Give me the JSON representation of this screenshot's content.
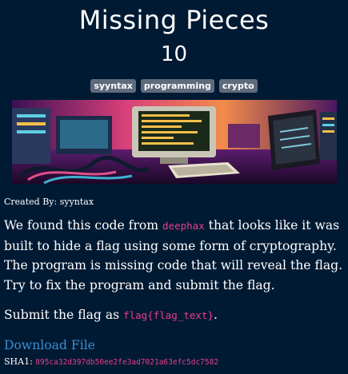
{
  "challenge": {
    "title": "Missing Pieces",
    "points": "10",
    "tags": [
      "syyntax",
      "programming",
      "crypto"
    ],
    "created_by_label": "Created By:",
    "created_by": "syyntax",
    "description": {
      "part1": "We found this code from ",
      "code1": "deephax",
      "part2": " that looks like it was built to hide a flag using some form of cryptography. The program is missing code that will reveal the flag. Try to fix the program and submit the flag."
    },
    "submit": {
      "prefix": "Submit the flag as ",
      "format": "flag{flag_text}",
      "suffix": "."
    },
    "download_label": "Download File",
    "sha1_label": "SHA1:",
    "sha1": "895ca32d397db50ee2fe3ad7021a63efc5dc7582"
  },
  "colors": {
    "background": "#001a33",
    "tag_bg": "#5f6b7c",
    "code_pink": "#e83e8c",
    "link_blue": "#3e8ed0"
  }
}
